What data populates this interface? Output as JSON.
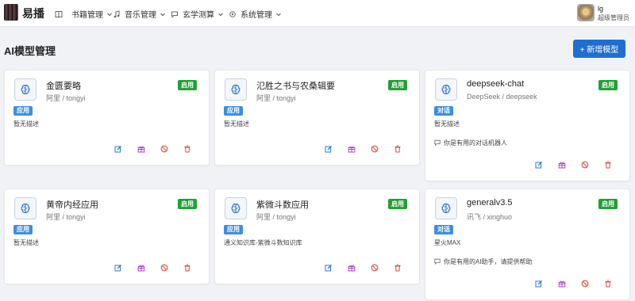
{
  "app": {
    "brand": "易播"
  },
  "nav": [
    {
      "label": "书籍管理",
      "icon": "book-icon"
    },
    {
      "label": "音乐管理",
      "icon": "music-icon"
    },
    {
      "label": "玄学测算",
      "icon": "chat-icon"
    },
    {
      "label": "系统管理",
      "icon": "gear-icon"
    }
  ],
  "user": {
    "name": "lg",
    "role": "超级管理员"
  },
  "page": {
    "title": "AI模型管理",
    "add_label": "+ 新增模型"
  },
  "cards": [
    {
      "title": "金匮要略",
      "provider": "阿里 / tongyi",
      "status": "启用",
      "type": "应用",
      "desc": "暂无描述",
      "prompt": ""
    },
    {
      "title": "氾胜之书与农桑辑要",
      "provider": "阿里 / tongyi",
      "status": "启用",
      "type": "应用",
      "desc": "暂无描述",
      "prompt": ""
    },
    {
      "title": "deepseek-chat",
      "provider": "DeepSeek / deepseek",
      "status": "启用",
      "type": "对话",
      "desc": "暂无描述",
      "prompt": "你是有用的对话机器人"
    },
    {
      "title": "黄帝内经应用",
      "provider": "阿里 / tongyi",
      "status": "启用",
      "type": "应用",
      "desc": "暂无描述",
      "prompt": ""
    },
    {
      "title": "紫微斗数应用",
      "provider": "阿里 / tongyi",
      "status": "启用",
      "type": "应用",
      "desc": "通义知识库-紫微斗数知识库",
      "prompt": ""
    },
    {
      "title": "generalv3.5",
      "provider": "讯飞 / xinghuo",
      "status": "启用",
      "type": "对话",
      "desc": "星火MAX",
      "prompt": "你是有用的AI助手，请提供帮助"
    }
  ],
  "colors": {
    "accent": "#1f6fd0",
    "enabled": "#22a035",
    "type_badge": "#3d8ee0",
    "edit": "#2b7bd4",
    "gift": "#b040c8",
    "disable": "#e0483f",
    "delete": "#e0483f"
  }
}
